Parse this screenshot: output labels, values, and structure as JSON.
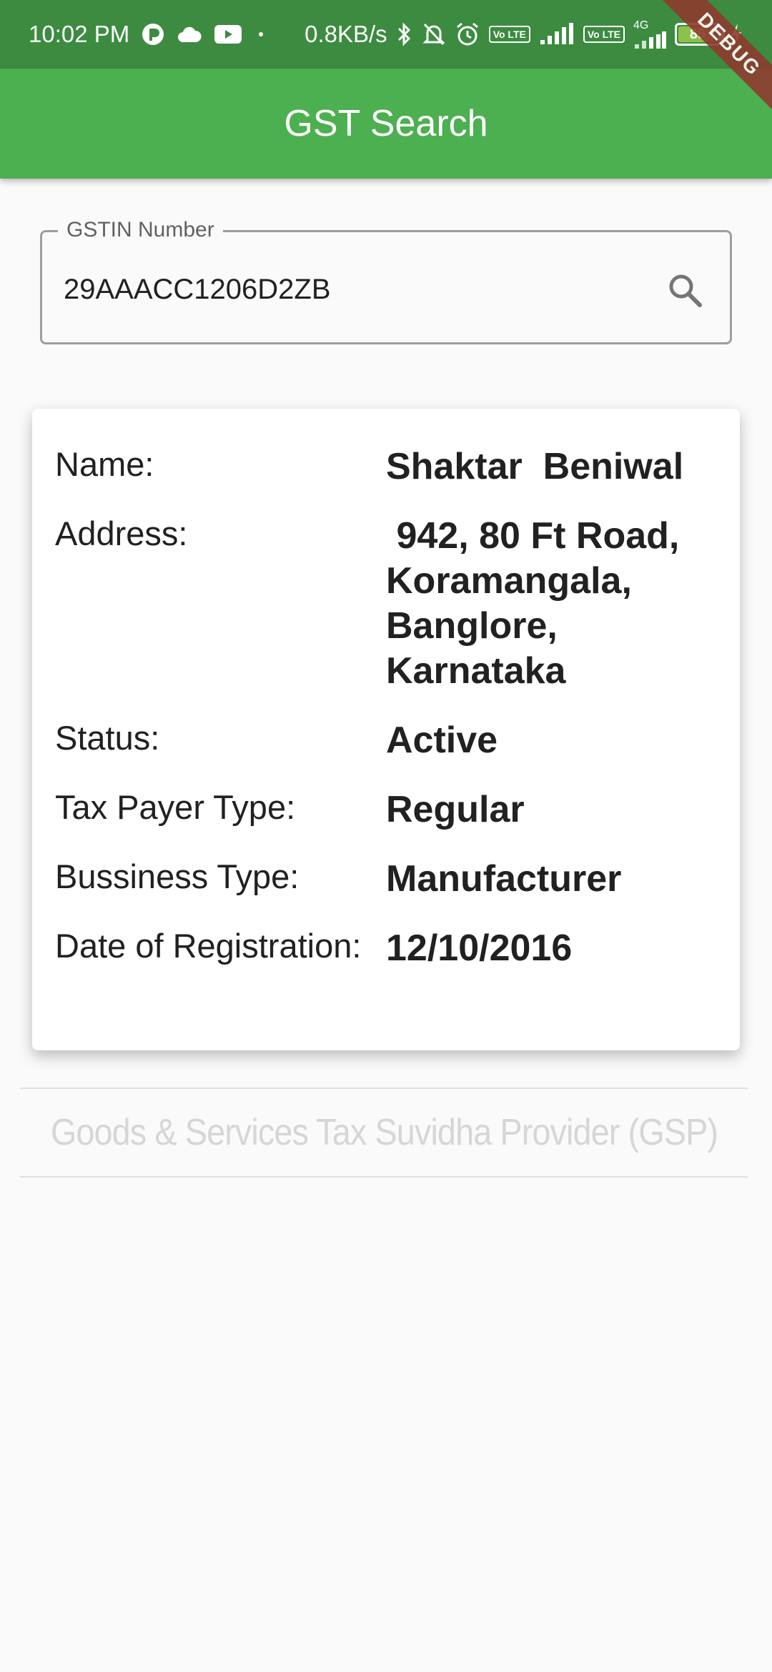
{
  "status_bar": {
    "time": "10:02 PM",
    "speed": "0.8KB/s",
    "network": "4G",
    "volte_label": "Vo LTE",
    "battery_level": "85"
  },
  "debug_banner": "DEBUG",
  "app_bar": {
    "title": "GST Search"
  },
  "search": {
    "label": "GSTIN Number",
    "value": "29AAACC1206D2ZB"
  },
  "details": {
    "name_label": "Name:",
    "name_value": "Shaktar  Beniwal",
    "address_label": "Address:",
    "address_value": " 942, 80 Ft Road, Koramangala, Banglore, Karnataka",
    "status_label": "Status:",
    "status_value": "Active",
    "taxpayer_label": "Tax Payer Type:",
    "taxpayer_value": "Regular",
    "business_label": "Bussiness Type:",
    "business_value": "Manufacturer",
    "date_label": "Date of Registration:",
    "date_value": "12/10/2016"
  },
  "footer": {
    "text": "Goods & Services Tax Suvidha Provider (GSP)"
  },
  "colors": {
    "status_bar": "#3c8b40",
    "app_bar": "#4caf50",
    "background": "#fafafa"
  }
}
